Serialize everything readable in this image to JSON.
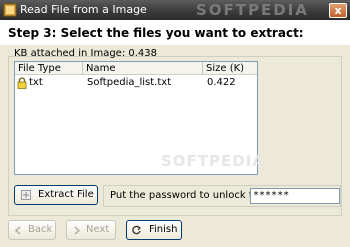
{
  "window": {
    "title": "Read File from a Image",
    "watermark": "SOFTPEDIA",
    "close_label": "x"
  },
  "header": {
    "step_title": "Step 3: Select the files you want to extract:"
  },
  "kb_info": "KB attached in Image: 0.438",
  "file_list": {
    "columns": [
      "File Type",
      "Name",
      "Size (K)"
    ],
    "rows": [
      {
        "type": "txt",
        "name": "Softpedia_list.txt",
        "size": "0.422"
      }
    ],
    "watermark": "SOFTPEDIA"
  },
  "buttons": {
    "extract": "Extract File",
    "back": "Back",
    "next": "Next",
    "finish": "Finish"
  },
  "password": {
    "label": "Put the password to unlock files:",
    "value": "******"
  }
}
